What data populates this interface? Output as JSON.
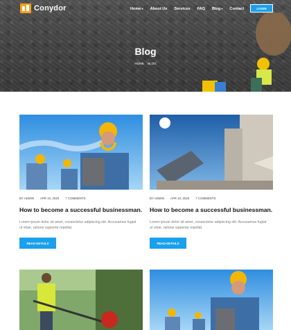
{
  "brand": {
    "name": "Conydor"
  },
  "nav": {
    "items": [
      {
        "label": "Home",
        "has_dropdown": true
      },
      {
        "label": "About Us",
        "has_dropdown": false
      },
      {
        "label": "Services",
        "has_dropdown": false
      },
      {
        "label": "FAQ",
        "has_dropdown": false
      },
      {
        "label": "Blog",
        "has_dropdown": true
      },
      {
        "label": "Contact",
        "has_dropdown": false
      }
    ],
    "login_label": "LOGIN"
  },
  "hero": {
    "title": "Blog",
    "breadcrumb": [
      "HOME",
      "BLOG"
    ]
  },
  "posts": [
    {
      "author": "BY ADMIN",
      "date": "APR 10, 2020",
      "comments": "7 COMMENTS",
      "title": "How to become a successful businessman.",
      "excerpt": "Lorem ipsum dolor sit amet, consectetur adipiscing elit. Accusamus fugiat ut vitae, ratione sapiente repellat.",
      "button": "READ DETAILS"
    },
    {
      "author": "BY ADMIN",
      "date": "APR 10, 2020",
      "comments": "7 COMMENTS",
      "title": "How to become a successful businessman.",
      "excerpt": "Lorem ipsum dolor sit amet, consectetur adipiscing elit. Accusamus fugiat ut vitae, ratione sapiente repellat.",
      "button": "READ DETAILS"
    }
  ],
  "colors": {
    "accent": "#1aa0ec",
    "logo": "#f7a11a",
    "hero_overlay": "#4a4a4a"
  }
}
